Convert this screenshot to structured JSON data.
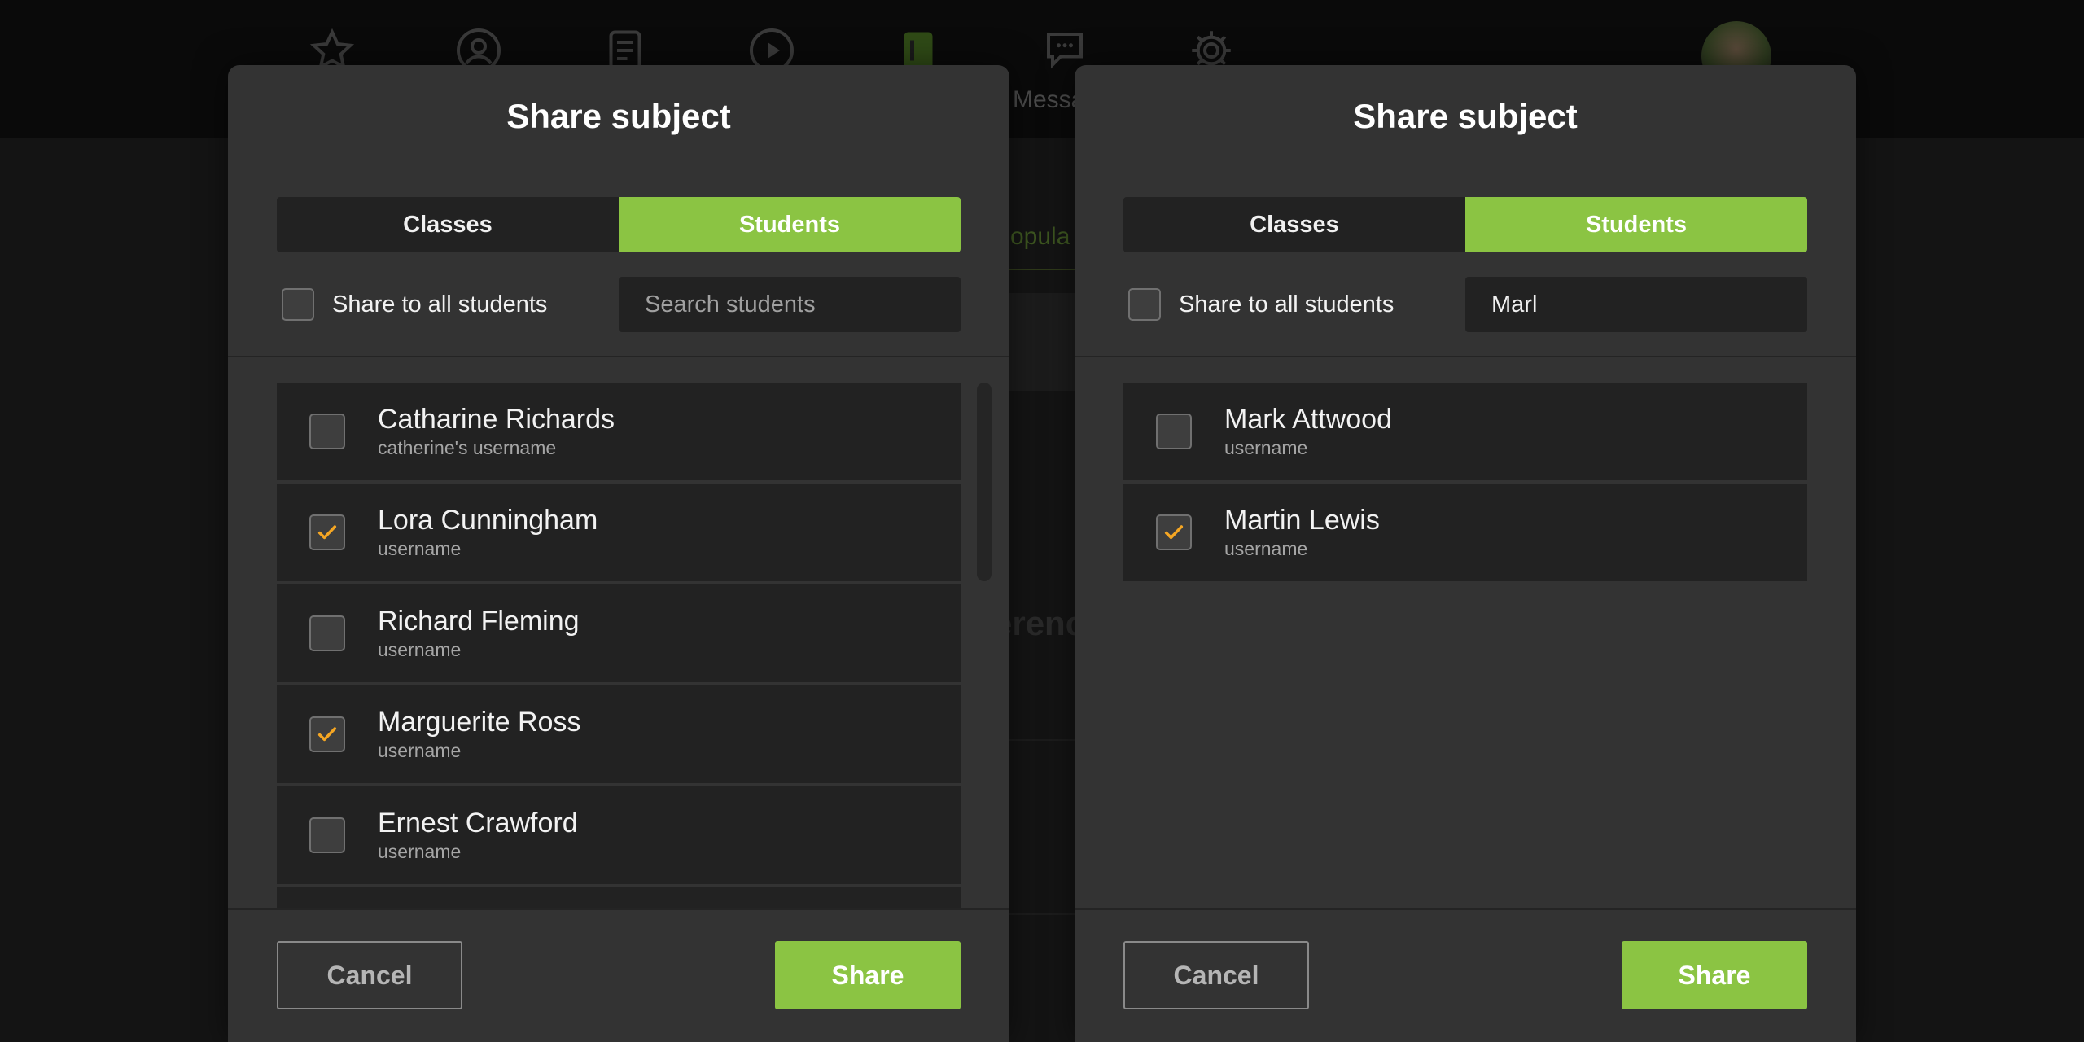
{
  "background": {
    "nav": [
      {
        "icon": "star-icon"
      },
      {
        "icon": "person-icon"
      },
      {
        "icon": "document-icon"
      },
      {
        "icon": "play-icon"
      },
      {
        "icon": "book-icon"
      },
      {
        "icon": "chat-icon",
        "label": "Messa"
      },
      {
        "icon": "gear-icon"
      }
    ],
    "pill_text": "opula",
    "heading_text": "erenc"
  },
  "colors": {
    "accent": "#8bc443",
    "check": "#f5a623",
    "modal_bg": "#333333",
    "row_bg": "#222222"
  },
  "modals": [
    {
      "title": "Share subject",
      "tabs": [
        "Classes",
        "Students"
      ],
      "active_tab": "Students",
      "share_all_label": "Share to all students",
      "search": {
        "value": "",
        "placeholder": "Search students"
      },
      "students": [
        {
          "name": "Catharine Richards",
          "username": "catherine's username",
          "checked": false
        },
        {
          "name": "Lora Cunningham",
          "username": "username",
          "checked": true
        },
        {
          "name": "Richard Fleming",
          "username": "username",
          "checked": false
        },
        {
          "name": "Marguerite Ross",
          "username": "username",
          "checked": true
        },
        {
          "name": "Ernest Crawford",
          "username": "username",
          "checked": false
        },
        {
          "name": "",
          "username": "",
          "checked": false
        }
      ],
      "cancel_label": "Cancel",
      "share_label": "Share"
    },
    {
      "title": "Share subject",
      "tabs": [
        "Classes",
        "Students"
      ],
      "active_tab": "Students",
      "share_all_label": "Share to all students",
      "search": {
        "value": "Marl",
        "placeholder": "Search students"
      },
      "students": [
        {
          "name": "Mark Attwood",
          "username": "username",
          "checked": false
        },
        {
          "name": "Martin Lewis",
          "username": "username",
          "checked": true
        }
      ],
      "cancel_label": "Cancel",
      "share_label": "Share"
    }
  ]
}
